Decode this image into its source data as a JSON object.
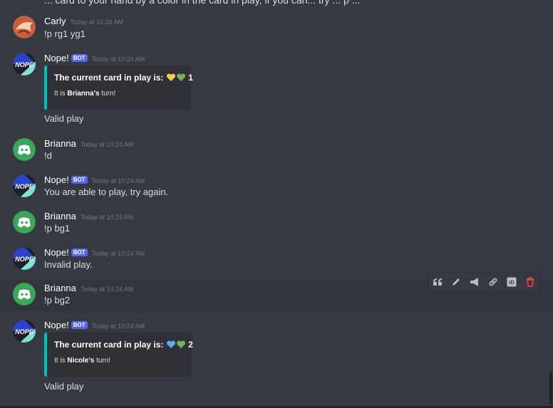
{
  "colors": {
    "background": "#36393f",
    "embed_accent": "#00c0c0",
    "bot_tag": "#5865f2",
    "discord_avatar": "#3ba55c",
    "delete": "#ed4245"
  },
  "top_partial_text": "... card to your hand by a color in the card in play, if you can... try ... p ...",
  "messages": [
    {
      "author": "Carly",
      "timestamp": "Today at 10:24 AM",
      "text": "!p rg1 yg1",
      "avatar_icon": "carly-avatar"
    },
    {
      "author": "Nope!",
      "bot_tag": "BOT",
      "timestamp": "Today at 10:24 AM",
      "embed": {
        "title": "The current card in play is:",
        "number": "1",
        "hearts": [
          "yellow",
          "green"
        ],
        "desc_prefix": "It is ",
        "desc_name": "Brianna's",
        "desc_suffix": " turn!"
      },
      "text": "Valid play",
      "avatar_icon": "nope-bot-avatar"
    },
    {
      "author": "Brianna",
      "timestamp": "Today at 10:24 AM",
      "text": "!d",
      "avatar_icon": "discord-avatar"
    },
    {
      "author": "Nope!",
      "bot_tag": "BOT",
      "timestamp": "Today at 10:24 AM",
      "text": "You are able to play, try again.",
      "avatar_icon": "nope-bot-avatar"
    },
    {
      "author": "Brianna",
      "timestamp": "Today at 10:24 AM",
      "text": "!p bg1",
      "avatar_icon": "discord-avatar"
    },
    {
      "author": "Nope!",
      "bot_tag": "BOT",
      "timestamp": "Today at 10:24 AM",
      "text": "Invalid play.",
      "avatar_icon": "nope-bot-avatar"
    },
    {
      "author": "Brianna",
      "timestamp": "Today at 10:24 AM",
      "text": "!p bg2",
      "avatar_icon": "discord-avatar"
    },
    {
      "author": "Nope!",
      "bot_tag": "BOT",
      "timestamp": "Today at 10:24 AM",
      "embed": {
        "title": "The current card in play is:",
        "number": "2",
        "hearts": [
          "blue",
          "green"
        ],
        "desc_prefix": "It is ",
        "desc_name": "Nicole's",
        "desc_suffix": " turn!"
      },
      "text": "Valid play",
      "avatar_icon": "nope-bot-avatar"
    }
  ],
  "toolbar": {
    "icons": [
      "quote-icon",
      "pencil-icon",
      "megaphone-icon",
      "link-icon",
      "id-icon",
      "trash-icon"
    ],
    "id_label": "ID"
  }
}
